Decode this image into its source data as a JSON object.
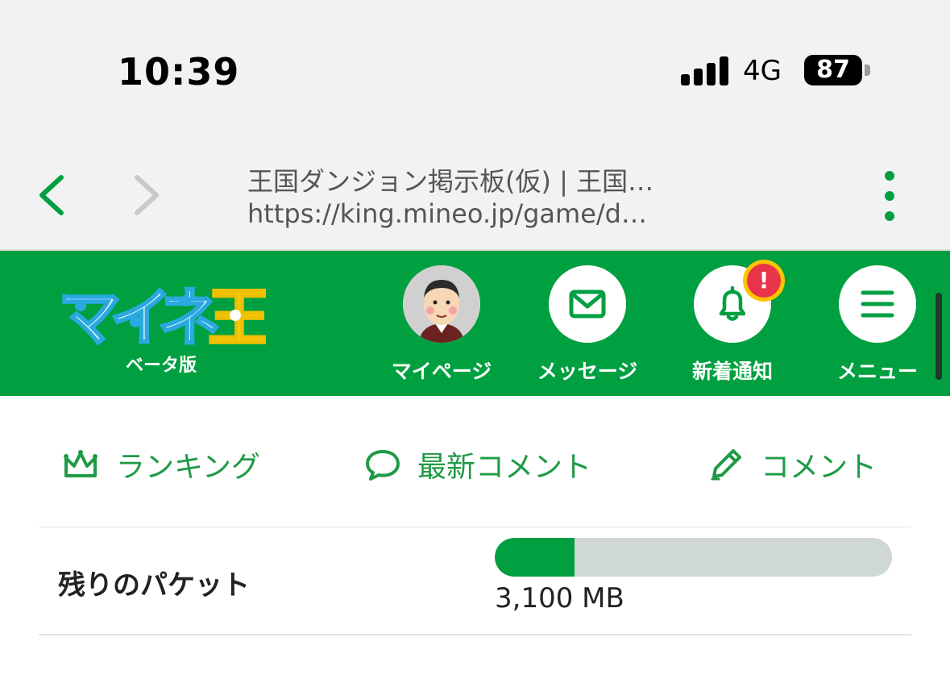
{
  "status_bar": {
    "time": "10:39",
    "network": "4G",
    "battery": "87",
    "signal_bars_filled": 4
  },
  "browser": {
    "page_title": "王国ダンジョン掲示板(仮) | 王国…",
    "url": "https://king.mineo.jp/game/d…",
    "back_icon": "chevron-left-icon",
    "forward_icon": "chevron-right-icon",
    "menu_icon": "kebab-icon"
  },
  "header": {
    "logo_text": "マイネ王",
    "beta_label": "ベータ版",
    "buttons": [
      {
        "label": "マイページ",
        "icon": "avatar-icon"
      },
      {
        "label": "メッセージ",
        "icon": "mail-icon"
      },
      {
        "label": "新着通知",
        "icon": "bell-icon",
        "badge": "!"
      },
      {
        "label": "メニュー",
        "icon": "hamburger-icon"
      }
    ]
  },
  "subnav": [
    {
      "label": "ランキング",
      "icon": "crown-icon"
    },
    {
      "label": "最新コメント",
      "icon": "speech-bubble-icon"
    },
    {
      "label": "コメント",
      "icon": "pencil-icon"
    }
  ],
  "packet": {
    "label": "残りのパケット",
    "value": "3,100 MB",
    "fill_fraction": 0.2
  },
  "colors": {
    "brand_green": "#00a040",
    "bar_track": "#cfd8d3",
    "badge_red": "#e8344a",
    "badge_ring": "#ffc400"
  }
}
